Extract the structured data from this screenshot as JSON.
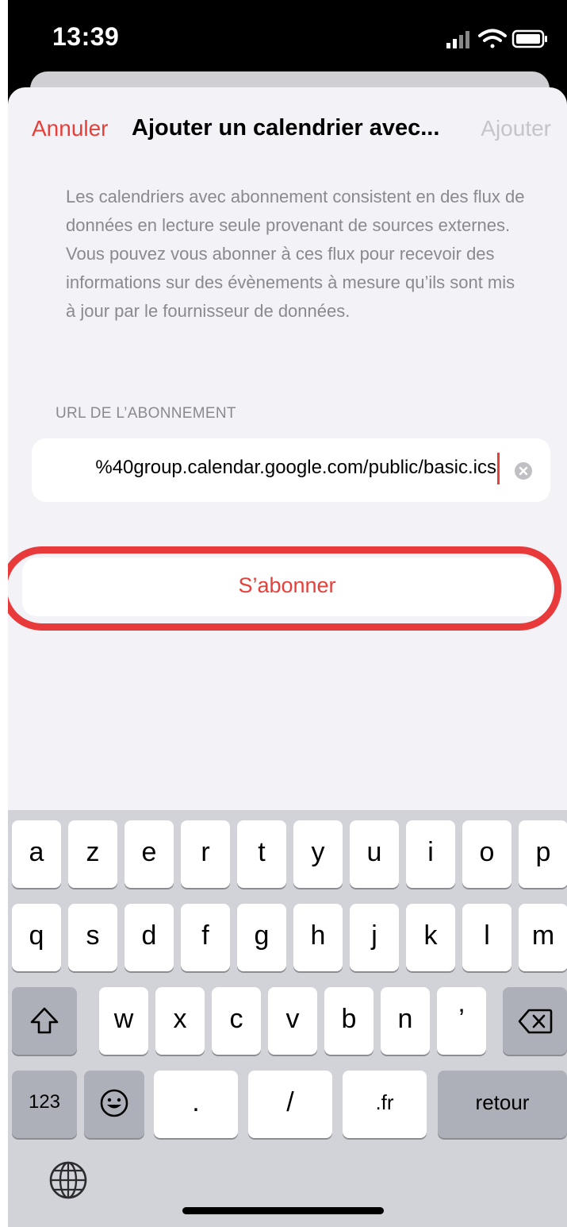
{
  "status_bar": {
    "time": "13:39"
  },
  "nav": {
    "cancel_label": "Annuler",
    "title": "Ajouter un calendrier avec...",
    "add_label": "Ajouter"
  },
  "description": "Les calendriers avec abonnement consistent en des flux de données en lecture seule provenant de sources externes. Vous pouvez vous abonner à ces flux pour recevoir des informations sur des évènements à mesure qu’ils sont mis à jour par le fournisseur de données.",
  "url_section": {
    "header": "URL DE L’ABONNEMENT",
    "value": "%40group.calendar.google.com/public/basic.ics"
  },
  "subscribe_label": "S’abonner",
  "keyboard": {
    "row1": [
      "a",
      "z",
      "e",
      "r",
      "t",
      "y",
      "u",
      "i",
      "o",
      "p"
    ],
    "row2": [
      "q",
      "s",
      "d",
      "f",
      "g",
      "h",
      "j",
      "k",
      "l",
      "m"
    ],
    "row3": [
      "w",
      "x",
      "c",
      "v",
      "b",
      "n",
      "’"
    ],
    "bottom": {
      "numbers": "123",
      "dot": ".",
      "slash": "/",
      "tld": ".fr",
      "return": "retour"
    }
  },
  "colors": {
    "accent": "#e5403a",
    "highlight": "#e83a3a",
    "sheet_bg": "#f2f2f7",
    "keyboard_bg": "#d1d3d9"
  }
}
